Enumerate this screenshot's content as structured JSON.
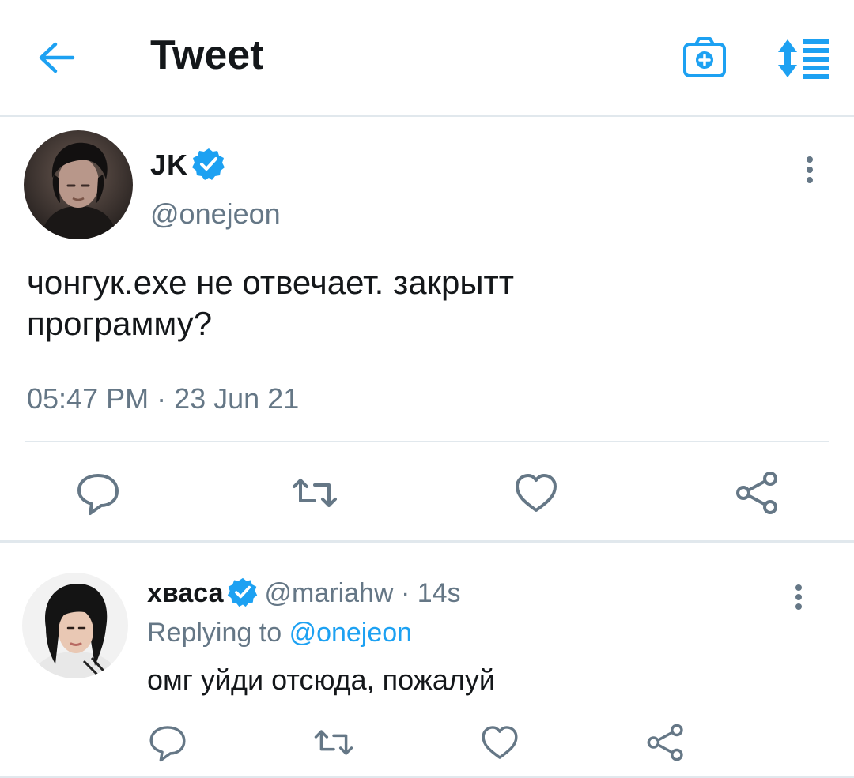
{
  "header": {
    "title": "Tweet",
    "back_icon": "arrow-left-icon",
    "camera_icon": "camera-add-icon",
    "sort_icon": "sort-list-icon",
    "accent": "#1da1f2"
  },
  "tweet": {
    "name": "JK",
    "handle": "@onejeon",
    "text_line1": "чонгук.exe не отвечает. закрытт",
    "text_line2": "программу?",
    "timestamp": "05:47 PM · 23 Jun 21",
    "verified": true,
    "actions": [
      "reply-icon",
      "retweet-icon",
      "like-icon",
      "share-icon"
    ]
  },
  "reply": {
    "name": "хваса",
    "handle": "@mariahw",
    "time": "· 14s",
    "replying_prefix": "Replying to",
    "replying_handle": "@onejeon",
    "text": "омг уйди отсюда, пожалуй",
    "verified": true,
    "actions": [
      "reply-icon",
      "retweet-icon",
      "like-icon",
      "share-icon"
    ]
  },
  "colors": {
    "text": "#14171a",
    "muted": "#657786",
    "accent": "#1da1f2",
    "divider": "#e1e8ed"
  }
}
